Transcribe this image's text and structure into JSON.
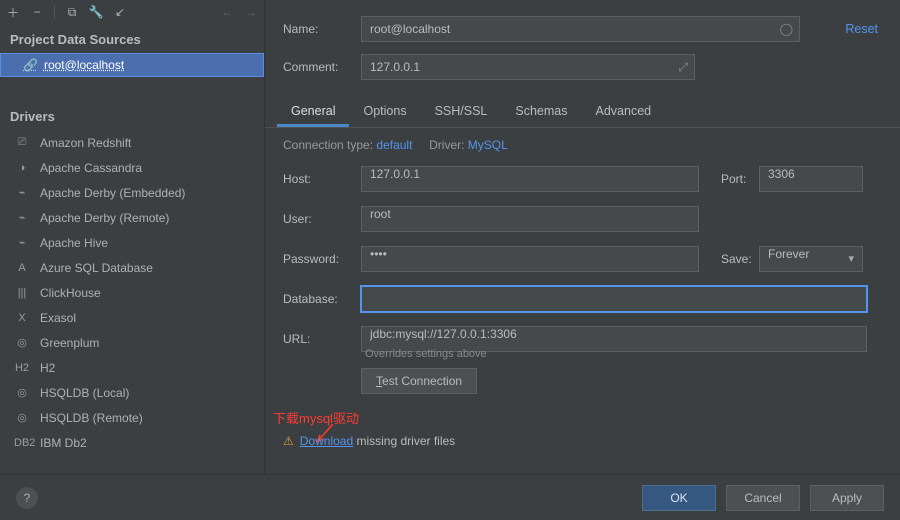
{
  "sidebar": {
    "section_ds": "Project Data Sources",
    "ds_item": "root@localhost",
    "section_drivers": "Drivers",
    "drivers": [
      {
        "icon": "⎚",
        "label": "Amazon Redshift"
      },
      {
        "icon": "◑",
        "label": "Apache Cassandra"
      },
      {
        "icon": "⌁",
        "label": "Apache Derby (Embedded)"
      },
      {
        "icon": "⌁",
        "label": "Apache Derby (Remote)"
      },
      {
        "icon": "⌁",
        "label": "Apache Hive"
      },
      {
        "icon": "A",
        "label": "Azure SQL Database"
      },
      {
        "icon": "|||",
        "label": "ClickHouse"
      },
      {
        "icon": "X",
        "label": "Exasol"
      },
      {
        "icon": "◎",
        "label": "Greenplum"
      },
      {
        "icon": "H2",
        "label": "H2"
      },
      {
        "icon": "◎",
        "label": "HSQLDB (Local)"
      },
      {
        "icon": "◎",
        "label": "HSQLDB (Remote)"
      },
      {
        "icon": "DB2",
        "label": "IBM Db2"
      }
    ]
  },
  "top": {
    "name_label": "Name:",
    "name_value": "root@localhost",
    "comment_label": "Comment:",
    "comment_value": "127.0.0.1",
    "reset": "Reset"
  },
  "tabs": [
    "General",
    "Options",
    "SSH/SSL",
    "Schemas",
    "Advanced"
  ],
  "conn": {
    "type_label": "Connection type:",
    "type_value": "default",
    "driver_label": "Driver:",
    "driver_value": "MySQL"
  },
  "fields": {
    "host_label": "Host:",
    "host_value": "127.0.0.1",
    "port_label": "Port:",
    "port_value": "3306",
    "user_label": "User:",
    "user_value": "root",
    "password_label": "Password:",
    "password_value": "••••",
    "save_label": "Save:",
    "save_value": "Forever",
    "database_label": "Database:",
    "database_value": "",
    "url_label": "URL:",
    "url_value": "jdbc:mysql://127.0.0.1:3306",
    "url_hint": "Overrides settings above",
    "test_btn": "Test Connection"
  },
  "warning": {
    "download": "Download",
    "text": " missing driver files",
    "annotation": "下载mysql驱动"
  },
  "footer": {
    "ok": "OK",
    "cancel": "Cancel",
    "apply": "Apply"
  }
}
